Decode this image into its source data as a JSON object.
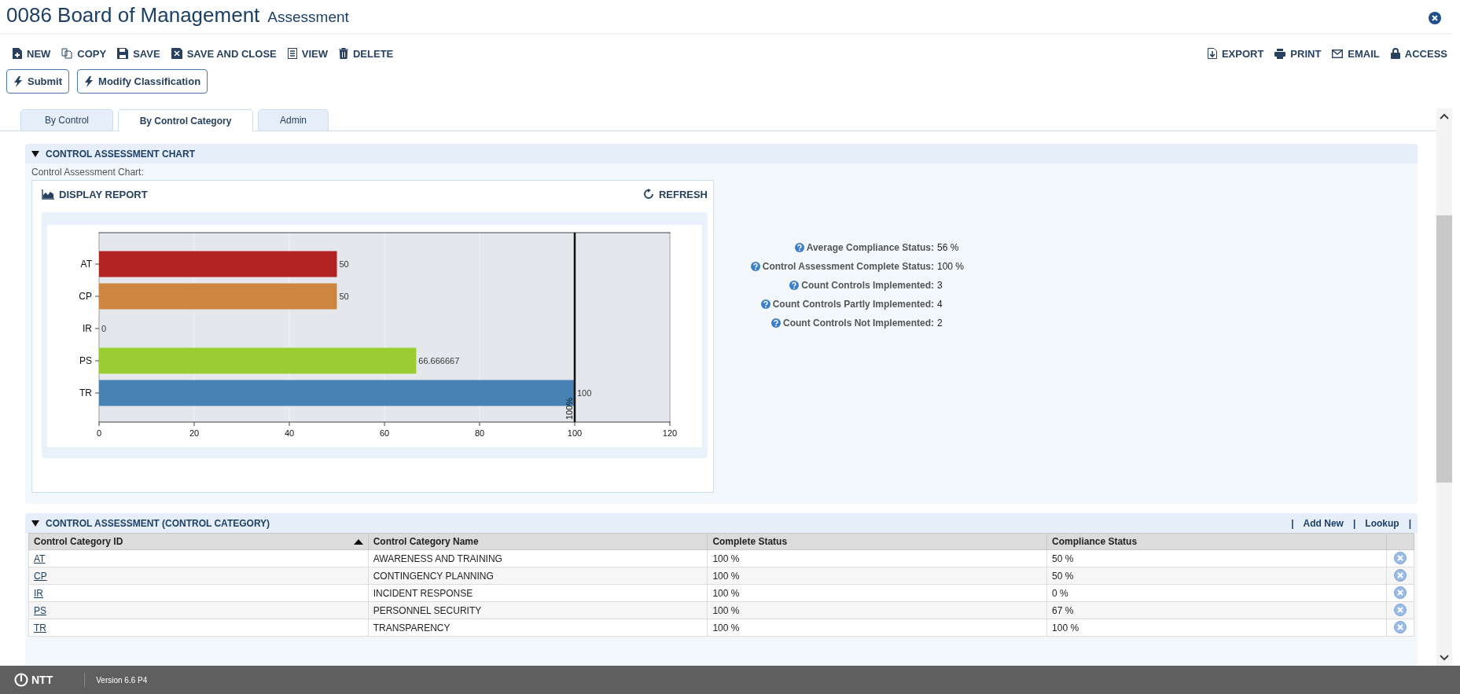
{
  "header": {
    "title": "0086 Board of Management",
    "subtitle": "Assessment"
  },
  "toolbar_left": [
    "NEW",
    "COPY",
    "SAVE",
    "SAVE AND CLOSE",
    "VIEW",
    "DELETE"
  ],
  "toolbar_right": [
    "EXPORT",
    "PRINT",
    "EMAIL",
    "ACCESS"
  ],
  "action_buttons": [
    "Submit",
    "Modify Classification"
  ],
  "tabs": [
    {
      "label": "By Control",
      "selected": false
    },
    {
      "label": "By Control Category",
      "selected": true
    },
    {
      "label": "Admin",
      "selected": false
    }
  ],
  "chart_section": {
    "title": "CONTROL ASSESSMENT CHART",
    "expanded": true,
    "field_label": "Control Assessment Chart:",
    "display_report": "DISPLAY REPORT",
    "refresh": "REFRESH",
    "chart_data": {
      "type": "bar",
      "orientation": "horizontal",
      "categories": [
        "AT",
        "CP",
        "IR",
        "PS",
        "TR"
      ],
      "series": [
        {
          "values": [
            50,
            50,
            0,
            66.666667,
            100
          ]
        }
      ],
      "colors": [
        "#b22222",
        "#cd853f",
        "#808080",
        "#9acd32",
        "#4682b4"
      ],
      "xlim": [
        0,
        120
      ],
      "xticks": [
        0,
        20,
        40,
        60,
        80,
        100,
        120
      ],
      "data_labels": true,
      "grid": true,
      "ref_lines": [
        {
          "axis": "x",
          "value": 100,
          "label": "100%"
        }
      ]
    }
  },
  "stats": [
    {
      "label": "Average Compliance Status:",
      "value": "56 %"
    },
    {
      "label": "Control Assessment Complete Status:",
      "value": "100 %"
    },
    {
      "label": "Count Controls Implemented:",
      "value": "3"
    },
    {
      "label": "Count Controls Partly Implemented:",
      "value": "4"
    },
    {
      "label": "Count Controls Not Implemented:",
      "value": "2"
    }
  ],
  "table_section": {
    "title": "CONTROL ASSESSMENT (CONTROL CATEGORY)",
    "expanded": true,
    "links": [
      {
        "kind": "separator",
        "text": "|"
      },
      {
        "kind": "link",
        "text": "Add New"
      },
      {
        "kind": "separator",
        "text": "|"
      },
      {
        "kind": "link",
        "text": "Lookup"
      },
      {
        "kind": "separator",
        "text": "|"
      }
    ],
    "columns": [
      {
        "label": "Control Category ID",
        "sorted": true
      },
      {
        "label": "Control Category Name",
        "sorted": false
      },
      {
        "label": "Complete Status",
        "sorted": false
      },
      {
        "label": "Compliance Status",
        "sorted": false
      }
    ],
    "rows": [
      {
        "id": "AT",
        "name": "AWARENESS AND TRAINING",
        "complete": "100 %",
        "compliance": "50 %"
      },
      {
        "id": "CP",
        "name": "CONTINGENCY PLANNING",
        "complete": "100 %",
        "compliance": "50 %"
      },
      {
        "id": "IR",
        "name": "INCIDENT RESPONSE",
        "complete": "100 %",
        "compliance": "0 %"
      },
      {
        "id": "PS",
        "name": "PERSONNEL SECURITY",
        "complete": "100 %",
        "compliance": "67 %"
      },
      {
        "id": "TR",
        "name": "TRANSPARENCY",
        "complete": "100 %",
        "compliance": "100 %"
      }
    ]
  },
  "footer": {
    "logo": "NTT",
    "version": "Version 6.6 P4"
  }
}
